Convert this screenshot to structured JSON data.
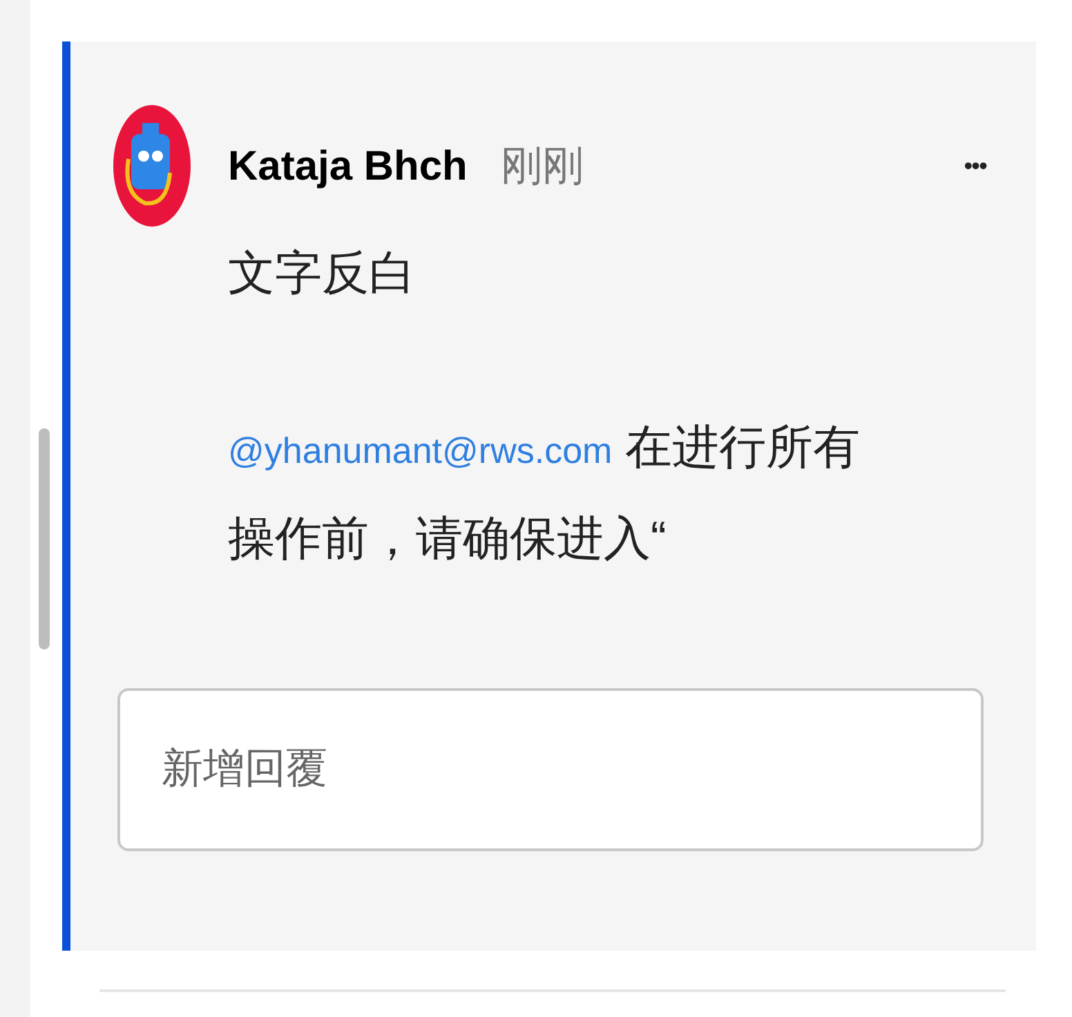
{
  "comment": {
    "author": "Kataja Bhch",
    "time": "刚刚",
    "menu": "•••",
    "body": "文字反白",
    "mention": "@yhanumant@rws.com",
    "message": "在进行所有操作前，请确保进入“"
  },
  "reply": {
    "placeholder": "新增回覆"
  }
}
